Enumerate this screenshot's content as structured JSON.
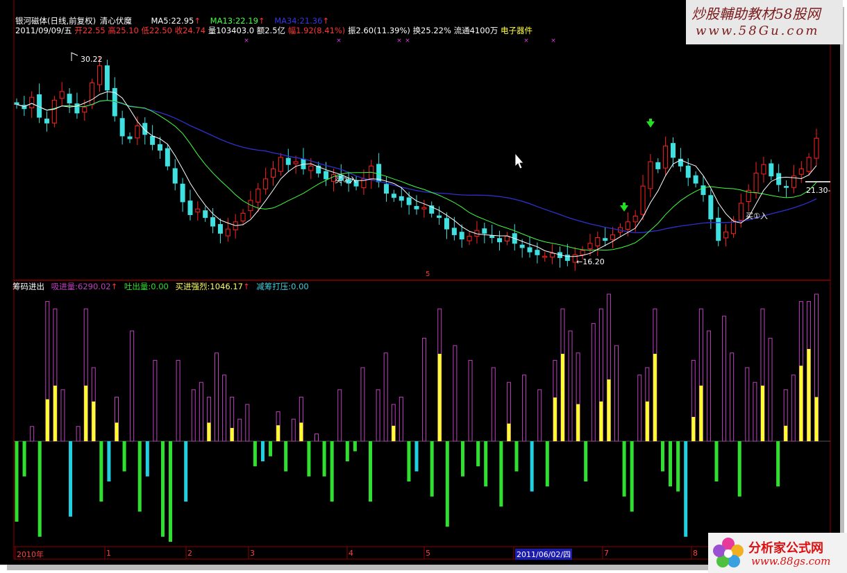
{
  "header1": {
    "title": "银河磁体(日线,前复权)",
    "indicator": "清心伏魔",
    "ma5_label": "MA5:",
    "ma5": "22.95",
    "ma13_label": "MA13:",
    "ma13": "22.19",
    "ma34_label": "MA34:",
    "ma34": "21.36",
    "arrow": "↑"
  },
  "header2": {
    "date": "2011/09/09/五",
    "open": "开22.55",
    "high": "高25.10",
    "low": "低22.50",
    "close": "收24.74",
    "vol": "量103403.0",
    "amount": "额2.5亿",
    "change": "幅1.92(8.41%)",
    "amplitude": "振2.60(11.39%)",
    "turnover": "换25.22%",
    "float": "流通4100万",
    "sector": "电子器件"
  },
  "annotations": {
    "high_label": "30.22",
    "low_label": "←16.20",
    "right_price": "21.30-",
    "buy1": "买①入",
    "buy2": "买②入",
    "marker_5": "5"
  },
  "indicator_header": {
    "name": "筹码进出",
    "absorb_label": "吸进量:",
    "absorb": "6290.02",
    "spit_label": "吐出量:",
    "spit": "0.00",
    "buy_label": "买进强烈:",
    "buy": "1046.17",
    "reduce_label": "减筹打压:",
    "reduce": "0.00",
    "arrow": "↑"
  },
  "xaxis": {
    "labels": [
      "2010年",
      "1",
      "2",
      "3",
      "4",
      "5",
      "2011/06/02/四",
      "7",
      "8"
    ]
  },
  "watermark_top": {
    "line1": "炒股輔助教材58股网",
    "line2": "www.58Gu.com"
  },
  "watermark_bottom": {
    "line1": "分析家公式网",
    "line2": "www.88gs.com"
  },
  "colors": {
    "up": "#ff2020",
    "down": "#40e0e0",
    "ma5": "#ffffff",
    "ma13": "#40ff40",
    "ma34": "#3030d0",
    "purple": "#c040c0",
    "yellow": "#ffff30",
    "green": "#30e030",
    "cyan": "#20d0e0",
    "grid": "#700000"
  },
  "chart_data": [
    {
      "type": "candlestick",
      "title": "银河磁体(日线,前复权)",
      "marked_values": {
        "high": 30.22,
        "low": 16.2,
        "current": 21.3
      },
      "series": [
        {
          "name": "MA5",
          "last": 22.95
        },
        {
          "name": "MA13",
          "last": 22.19
        },
        {
          "name": "MA34",
          "last": 21.36
        }
      ],
      "closes": [
        27.1,
        26.8,
        27.6,
        26.2,
        25.8,
        27.4,
        28.0,
        27.2,
        26.5,
        26.9,
        28.6,
        29.8,
        28.1,
        26.3,
        24.9,
        24.7,
        25.6,
        25.0,
        24.3,
        23.9,
        22.8,
        21.6,
        20.3,
        19.4,
        19.8,
        19.2,
        18.6,
        18.1,
        18.4,
        18.9,
        19.5,
        20.4,
        21.2,
        21.9,
        22.6,
        23.4,
        22.9,
        23.1,
        22.6,
        22.8,
        22.3,
        21.9,
        22.2,
        21.8,
        21.6,
        21.4,
        21.9,
        22.8,
        21.7,
        20.9,
        20.6,
        20.4,
        20.1,
        19.8,
        19.9,
        19.5,
        19.2,
        18.4,
        18.0,
        17.7,
        17.9,
        18.3,
        18.1,
        17.8,
        17.5,
        17.9,
        17.4,
        17.1,
        16.8,
        16.6,
        16.5,
        16.7,
        16.4,
        16.2,
        16.6,
        16.9,
        17.4,
        17.8,
        17.6,
        18.0,
        18.5,
        18.9,
        19.3,
        21.4,
        23.1,
        22.6,
        24.2,
        23.4,
        22.8,
        22.0,
        21.6,
        20.8,
        19.1,
        17.6,
        18.2,
        19.0,
        20.2,
        21.1,
        22.3,
        22.9,
        22.1,
        21.5,
        21.3,
        22.1,
        22.6,
        23.4,
        24.74
      ],
      "events": [
        {
          "label": "买②入"
        },
        {
          "label": "买①入"
        }
      ]
    },
    {
      "type": "bar",
      "title": "筹码进出",
      "series": [
        {
          "name": "吸进量",
          "last": 6290.02
        },
        {
          "name": "吐出量",
          "last": 0.0
        },
        {
          "name": "买进强烈",
          "last": 1046.17
        },
        {
          "name": "减筹打压",
          "last": 0.0
        }
      ],
      "values": [
        -0.8,
        -0.35,
        0.1,
        -0.95,
        0.95,
        0.9,
        0.35,
        -0.75,
        0.1,
        0.9,
        0.5,
        -0.6,
        -0.4,
        0.3,
        -0.3,
        0.75,
        -0.7,
        -0.35,
        0.55,
        -0.95,
        -1.0,
        0.55,
        -0.6,
        0.35,
        0.4,
        0.3,
        0.6,
        0.45,
        0.3,
        0.15,
        0.25,
        -0.25,
        -0.2,
        -0.15,
        0.2,
        -0.3,
        0.15,
        0.3,
        -0.35,
        0.05,
        -0.35,
        -0.6,
        0.35,
        -0.2,
        -0.1,
        0.5,
        -0.6,
        0.35,
        0.6,
        0.25,
        0.3,
        -0.4,
        -0.3,
        0.7,
        -0.55,
        0.9,
        -0.85,
        0.65,
        -0.35,
        0.55,
        -0.25,
        -0.45,
        0.5,
        -0.65,
        0.4,
        -0.3,
        0.45,
        -0.5,
        0.35,
        -0.45,
        0.55,
        0.9,
        0.75,
        0.6,
        -0.4,
        0.8,
        0.9,
        1.0,
        0.65,
        -0.55,
        -0.7,
        0.45,
        0.5,
        0.9,
        -0.3,
        -0.45,
        -0.5,
        -0.95,
        0.55,
        0.9,
        0.75,
        -0.4,
        0.85,
        0.6,
        -0.55,
        0.5,
        0.4,
        0.9,
        0.7,
        -0.45,
        0.35,
        0.45,
        0.95,
        0.95,
        1.0
      ],
      "colors_note": [
        "吸进量",
        "吐出量",
        "买进强烈",
        "减筹打压"
      ]
    }
  ]
}
